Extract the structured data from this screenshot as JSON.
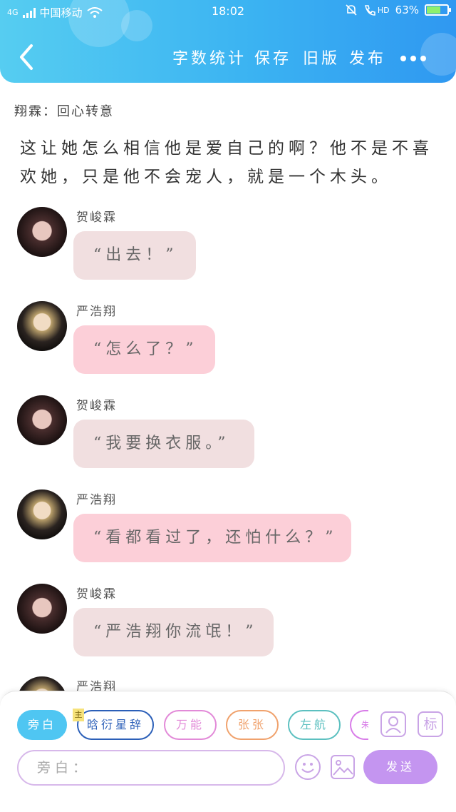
{
  "status_bar": {
    "network": "4G",
    "carrier": "中国移动",
    "time": "18:02",
    "hd": "HD",
    "battery": "63%",
    "battery_level": 0.63
  },
  "header": {
    "menu": [
      "字数统计",
      "保存",
      "旧版",
      "发布"
    ],
    "colors": {
      "gradient_start": "#56cdf1",
      "gradient_end": "#2f98f1"
    }
  },
  "content": {
    "title": "翔霖：回心转意",
    "narration": "这让她怎么相信他是爱自己的啊？他不是不喜欢她，只是他不会宠人，就是一个木头。",
    "messages": [
      {
        "speaker": "贺峻霖",
        "text": "“出去！”"
      },
      {
        "speaker": "严浩翔",
        "text": "“怎么了？”"
      },
      {
        "speaker": "贺峻霖",
        "text": "“我要换衣服。”"
      },
      {
        "speaker": "严浩翔",
        "text": "“看都看过了，还怕什么？”"
      },
      {
        "speaker": "贺峻霖",
        "text": "“严浩翔你流氓！”"
      },
      {
        "speaker": "严浩翔",
        "text": ""
      }
    ]
  },
  "composer": {
    "chips": [
      "旁白",
      "晗衍星辞",
      "万能",
      "张张",
      "左航",
      "朱"
    ],
    "chip_tag": "主",
    "placeholder": "旁白：",
    "send_label": "发送",
    "profile_icon": "profile-icon",
    "tag_button_label": "标"
  }
}
